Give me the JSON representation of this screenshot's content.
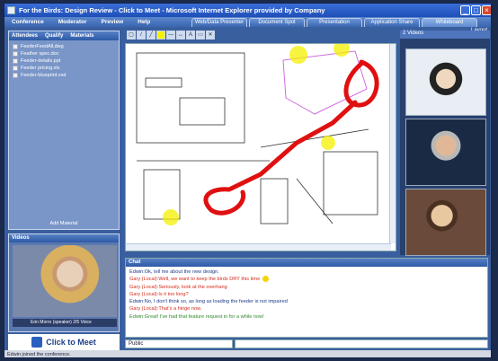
{
  "window": {
    "title": "For the Birds: Design Review - Click to Meet - Microsoft Internet Explorer provided by Company"
  },
  "menu": [
    "Conference",
    "Moderator",
    "Preview",
    "Help"
  ],
  "tabs": [
    "Web/Data Presenter",
    "Document Spot",
    "Presentation",
    "Application Share",
    "Whiteboard"
  ],
  "layout_label": "Layout",
  "attendees_panel": {
    "headers": [
      "Attendees",
      "Qualify",
      "Materials"
    ],
    "files": [
      "FeederFeedAll.dwg",
      "Feather spec.doc",
      "Feeder-details.ppt",
      "Feeder pricing.xls",
      "Feeder-blueprint.vsd"
    ],
    "add_button": "Add Material"
  },
  "video_panel": {
    "title": "Videos",
    "caption": "Erin Morro (speaker) 2/5 Voice"
  },
  "logo_text": "Click to Meet",
  "right_videos_header": "2 Videos",
  "chat": {
    "title": "Chat",
    "lines": [
      {
        "text": "Edwin:Ok, tell me about the new design.",
        "color": "blue"
      },
      {
        "text": "Gary (Local):Well, we want to keep the birds DRY this time",
        "color": "red",
        "smiley": true
      },
      {
        "text": "Gary (Local):Seriously, look at the overhang",
        "color": "red"
      },
      {
        "text": "Gary (Local):Is it too long?",
        "color": "red"
      },
      {
        "text": "Edwin:No, I don't think so, as long as loading the feeder is not impaired",
        "color": "blue"
      },
      {
        "text": "Gary (Local):That's a hinge now.",
        "color": "red"
      },
      {
        "text": "Edwin:Great! I've had that feature request in for a while now!",
        "color": "green"
      }
    ],
    "input_select": "Public"
  },
  "status": "Edwin joined the conference."
}
